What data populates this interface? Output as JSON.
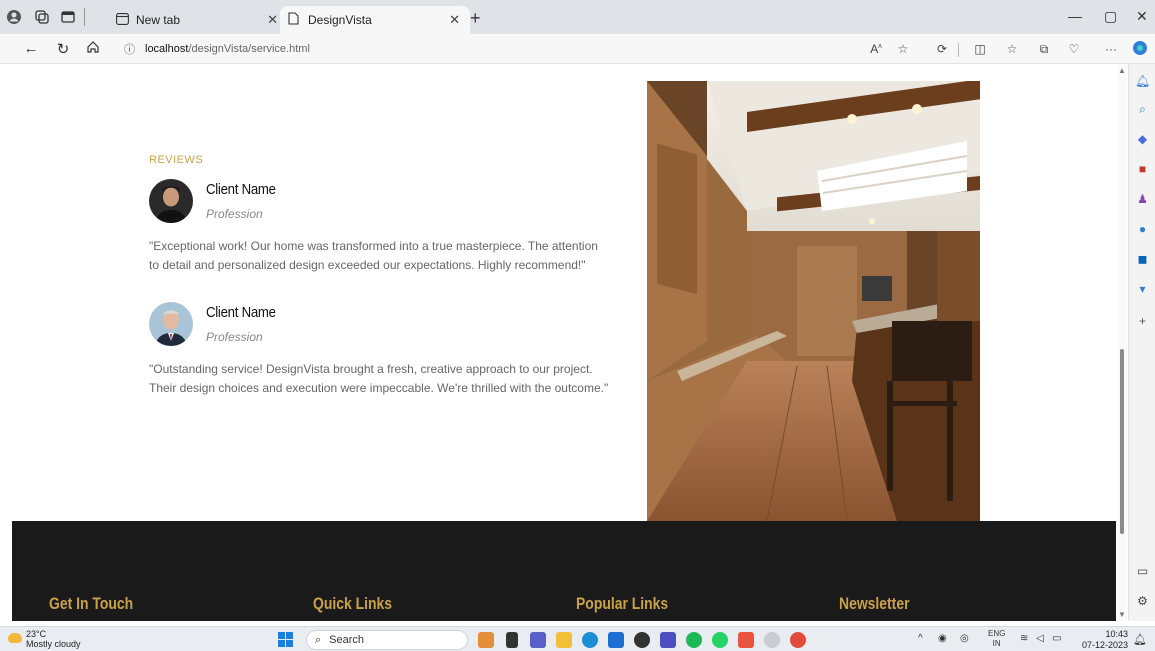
{
  "browser": {
    "tabs": [
      {
        "label": "New tab",
        "active": false
      },
      {
        "label": "DesignVista",
        "active": true
      }
    ],
    "url_host": "localhost",
    "url_path": "/designVista/service.html"
  },
  "reviews": {
    "title": "REVIEWS",
    "items": [
      {
        "name": "Client Name",
        "profession": "Profession",
        "text": "\"Exceptional work! Our home was transformed into a true masterpiece. The attention to detail and personalized design exceeded our expectations. Highly recommend!\""
      },
      {
        "name": "Client Name",
        "profession": "Profession",
        "text": "\"Outstanding service! DesignVista brought a fresh, creative approach to our project. Their design choices and execution were impeccable. We're thrilled with the outcome.\""
      }
    ]
  },
  "footer": {
    "headings": [
      "Get In Touch",
      "Quick Links",
      "Popular Links",
      "Newsletter"
    ]
  },
  "taskbar": {
    "weather_temp": "23°C",
    "weather_desc": "Mostly cloudy",
    "search_placeholder": "Search",
    "lang": "ENG",
    "region": "IN",
    "time": "10:43",
    "date": "07-12-2023"
  },
  "colors": {
    "accent": "#c9a24a",
    "footer_bg": "#1a1a1a"
  }
}
